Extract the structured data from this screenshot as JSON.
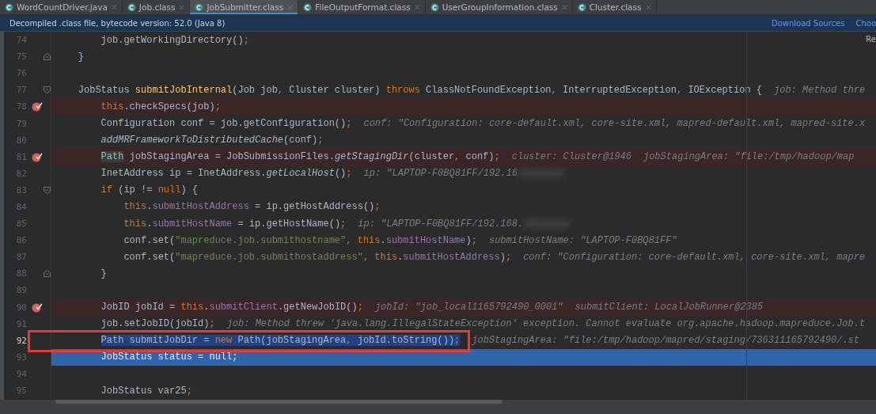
{
  "tabs": [
    {
      "label": "WordCountDriver.java",
      "selected": false
    },
    {
      "label": "Job.class",
      "selected": false
    },
    {
      "label": "JobSubmitter.class",
      "selected": true
    },
    {
      "label": "FileOutputFormat.class",
      "selected": false
    },
    {
      "label": "UserGroupInformation.class",
      "selected": false
    },
    {
      "label": "Cluster.class",
      "selected": false
    }
  ],
  "notice": {
    "message": "Decompiled .class file, bytecode version: 52.0 (Java 8)",
    "links": [
      "Download Sources",
      "Choo"
    ]
  },
  "editor": {
    "corner_label": "Re",
    "lines": [
      {
        "number": "74",
        "kind": "normal",
        "selected": false,
        "fold_start": false,
        "fold_end": false,
        "tokens": [
          {
            "kind": "plain",
            "text": "        job.getWorkingDirectory()"
          },
          {
            "kind": "punct",
            "text": ";"
          }
        ]
      },
      {
        "number": "75",
        "kind": "normal",
        "selected": false,
        "fold_start": false,
        "fold_end": true,
        "tokens": [
          {
            "kind": "plain",
            "text": "    }"
          }
        ]
      },
      {
        "number": "76",
        "kind": "normal",
        "selected": false,
        "fold_start": false,
        "fold_end": false
      },
      {
        "number": "77",
        "kind": "normal",
        "selected": false,
        "fold_start": true,
        "fold_end": false,
        "tokens": [
          {
            "kind": "plain",
            "text": "    JobStatus "
          },
          {
            "kind": "decl",
            "text": "submitJobInternal"
          },
          {
            "kind": "plain",
            "text": "(Job job"
          },
          {
            "kind": "punct",
            "text": ","
          },
          {
            "kind": "plain",
            "text": " Cluster cluster) "
          },
          {
            "kind": "keyword",
            "text": "throws"
          },
          {
            "kind": "plain",
            "text": " ClassNotFoundException"
          },
          {
            "kind": "punct",
            "text": ","
          },
          {
            "kind": "plain",
            "text": " InterruptedException"
          },
          {
            "kind": "punct",
            "text": ","
          },
          {
            "kind": "plain",
            "text": " IOException {"
          }
        ],
        "hints": [
          "job: Method thre"
        ]
      },
      {
        "number": "78",
        "kind": "breakpoint",
        "selected": false,
        "fold_start": false,
        "fold_end": false,
        "tokens": [
          {
            "kind": "keyword",
            "text": "        this"
          },
          {
            "kind": "plain",
            "text": ".checkSpecs(job)"
          },
          {
            "kind": "punct",
            "text": ";"
          }
        ]
      },
      {
        "number": "79",
        "kind": "normal",
        "selected": false,
        "fold_start": false,
        "fold_end": false,
        "tokens": [
          {
            "kind": "plain",
            "text": "        Configuration conf = job.getConfiguration()"
          },
          {
            "kind": "punct",
            "text": ";"
          }
        ],
        "hints": [
          "conf: \"Configuration: core-default.xml, core-site.xml, mapred-default.xml, mapred-site.x"
        ]
      },
      {
        "number": "80",
        "kind": "normal",
        "selected": false,
        "fold_start": false,
        "fold_end": false,
        "tokens": [
          {
            "kind": "static",
            "text": "        addMRFrameworkToDistributedCache"
          },
          {
            "kind": "plain",
            "text": "(conf)"
          },
          {
            "kind": "punct",
            "text": ";"
          }
        ]
      },
      {
        "number": "81",
        "kind": "breakpoint",
        "selected": false,
        "fold_start": false,
        "fold_end": false,
        "tokens": [
          {
            "kind": "usage",
            "text": "        Path"
          },
          {
            "kind": "plain",
            "text": " jobStagingArea = JobSubmissionFiles."
          },
          {
            "kind": "static",
            "text": "getStagingDir"
          },
          {
            "kind": "plain",
            "text": "(cluster"
          },
          {
            "kind": "punct",
            "text": ","
          },
          {
            "kind": "plain",
            "text": " conf)"
          },
          {
            "kind": "punct",
            "text": ";"
          }
        ],
        "hints": [
          "cluster: Cluster@1946",
          "jobStagingArea: \"file:/tmp/hadoop/map"
        ]
      },
      {
        "number": "82",
        "kind": "normal",
        "selected": false,
        "fold_start": false,
        "fold_end": false,
        "tokens": [
          {
            "kind": "plain",
            "text": "        InetAddress ip = InetAddress."
          },
          {
            "kind": "static",
            "text": "getLocalHost"
          },
          {
            "kind": "plain",
            "text": "()"
          },
          {
            "kind": "punct",
            "text": ";"
          }
        ],
        "hints": [
          "ip: \"LAPTOP-F0BQ81FF/192.16"
        ],
        "redacted": true
      },
      {
        "number": "83",
        "kind": "normal",
        "selected": false,
        "fold_start": true,
        "fold_end": false,
        "tokens": [
          {
            "kind": "keyword",
            "text": "        if"
          },
          {
            "kind": "plain",
            "text": " (ip != "
          },
          {
            "kind": "keyword",
            "text": "null"
          },
          {
            "kind": "plain",
            "text": ") {"
          }
        ]
      },
      {
        "number": "84",
        "kind": "normal",
        "selected": false,
        "fold_start": false,
        "fold_end": false,
        "tokens": [
          {
            "kind": "keyword",
            "text": "            this"
          },
          {
            "kind": "plain",
            "text": "."
          },
          {
            "kind": "field",
            "text": "submitHostAddress"
          },
          {
            "kind": "plain",
            "text": " = ip.getHostAddress()"
          },
          {
            "kind": "punct",
            "text": ";"
          }
        ]
      },
      {
        "number": "85",
        "kind": "normal",
        "selected": false,
        "fold_start": false,
        "fold_end": false,
        "tokens": [
          {
            "kind": "keyword",
            "text": "            this"
          },
          {
            "kind": "plain",
            "text": "."
          },
          {
            "kind": "field",
            "text": "submitHostName"
          },
          {
            "kind": "plain",
            "text": " = ip.getHostName()"
          },
          {
            "kind": "punct",
            "text": ";"
          }
        ],
        "hints": [
          "ip: \"LAPTOP-F0BQ81FF/192.168."
        ],
        "redacted": true
      },
      {
        "number": "86",
        "kind": "normal",
        "selected": false,
        "fold_start": false,
        "fold_end": false,
        "tokens": [
          {
            "kind": "plain",
            "text": "            conf.set("
          },
          {
            "kind": "string",
            "text": "\"mapreduce.job.submithostname\""
          },
          {
            "kind": "punct",
            "text": ","
          },
          {
            "kind": "keyword",
            "text": " this"
          },
          {
            "kind": "plain",
            "text": "."
          },
          {
            "kind": "field",
            "text": "submitHostName"
          },
          {
            "kind": "plain",
            "text": ")"
          },
          {
            "kind": "punct",
            "text": ";"
          }
        ],
        "hints": [
          "submitHostName: \"LAPTOP-F0BQ81FF\""
        ]
      },
      {
        "number": "87",
        "kind": "normal",
        "selected": false,
        "fold_start": false,
        "fold_end": false,
        "tokens": [
          {
            "kind": "plain",
            "text": "            conf.set("
          },
          {
            "kind": "string",
            "text": "\"mapreduce.job.submithostaddress\""
          },
          {
            "kind": "punct",
            "text": ","
          },
          {
            "kind": "keyword",
            "text": " this"
          },
          {
            "kind": "plain",
            "text": "."
          },
          {
            "kind": "field",
            "text": "submitHostAddress"
          },
          {
            "kind": "plain",
            "text": ")"
          },
          {
            "kind": "punct",
            "text": ";"
          }
        ],
        "hints": [
          "conf: \"Configuration: core-default.xml, core-site.xml, mapre"
        ]
      },
      {
        "number": "88",
        "kind": "normal",
        "selected": false,
        "fold_start": false,
        "fold_end": true,
        "tokens": [
          {
            "kind": "plain",
            "text": "        }"
          }
        ]
      },
      {
        "number": "89",
        "kind": "normal",
        "selected": false,
        "fold_start": false,
        "fold_end": false
      },
      {
        "number": "90",
        "kind": "breakpoint",
        "selected": false,
        "fold_start": false,
        "fold_end": false,
        "tokens": [
          {
            "kind": "plain",
            "text": "        JobID jobId = "
          },
          {
            "kind": "keyword",
            "text": "this"
          },
          {
            "kind": "plain",
            "text": "."
          },
          {
            "kind": "field",
            "text": "submitClient"
          },
          {
            "kind": "plain",
            "text": ".getNewJobID()"
          },
          {
            "kind": "punct",
            "text": ";"
          }
        ],
        "hints": [
          "jobId: \"job_local1165792490_0001\"",
          "submitClient: LocalJobRunner@2385"
        ]
      },
      {
        "number": "91",
        "kind": "normal",
        "selected": false,
        "fold_start": false,
        "fold_end": false,
        "tokens": [
          {
            "kind": "plain",
            "text": "        job.setJobID(jobId)"
          },
          {
            "kind": "punct",
            "text": ";"
          }
        ],
        "hints": [
          "job: Method threw 'java.lang.IllegalStateException' exception. Cannot evaluate org.apache.hadoop.mapreduce.Job.t"
        ]
      },
      {
        "number": "92",
        "kind": "normal",
        "selected": true,
        "fold_start": false,
        "fold_end": false,
        "tokens": [
          {
            "kind": "plain",
            "text": "        Path submitJobDir = "
          },
          {
            "kind": "keyword",
            "text": "new"
          },
          {
            "kind": "plain",
            "text": " Path(jobStagingArea"
          },
          {
            "kind": "punct",
            "text": ","
          },
          {
            "kind": "plain",
            "text": " jobId.toString())"
          },
          {
            "kind": "punct",
            "text": ";"
          }
        ],
        "hints": [
          "jobStagingArea: \"file:/tmp/hadoop/mapred/staging/736311165792490/.st"
        ]
      },
      {
        "number": "93",
        "kind": "execution",
        "selected": false,
        "fold_start": false,
        "fold_end": false,
        "tokens": [
          {
            "kind": "plain",
            "text": "        JobStatus status = "
          },
          {
            "kind": "keyword",
            "text": "null"
          },
          {
            "kind": "punct",
            "text": ";"
          }
        ]
      },
      {
        "number": "94",
        "kind": "normal",
        "selected": false,
        "fold_start": false,
        "fold_end": false
      },
      {
        "number": "95",
        "kind": "normal",
        "selected": false,
        "fold_start": false,
        "fold_end": false,
        "tokens": [
          {
            "kind": "plain",
            "text": "        JobStatus var25"
          },
          {
            "kind": "punct",
            "text": ";"
          }
        ]
      }
    ]
  }
}
